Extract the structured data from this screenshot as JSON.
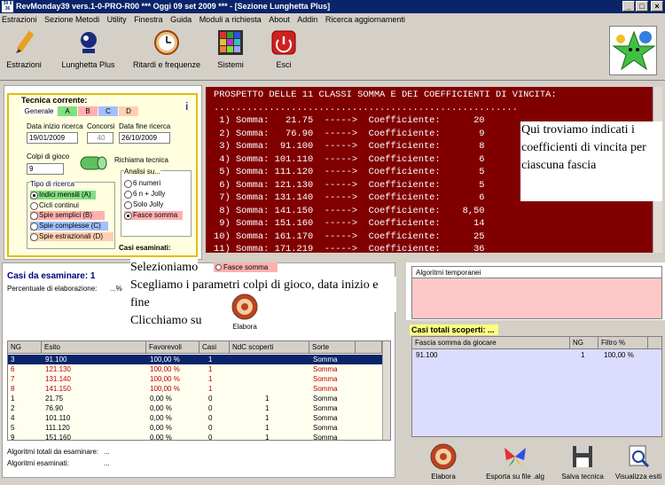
{
  "window": {
    "title": "RevMonday39 vers.1-0-PRO-R00   ***  Oggi 09 set 2009  ***   - [Sezione Lunghetta Plus]",
    "app_icon_text": "39 II 36"
  },
  "menu": [
    "Estrazioni",
    "Sezione Metodi",
    "Utility",
    "Finestra",
    "Guida",
    "Moduli a richiesta",
    "About",
    "Addin",
    "Ricerca aggiornamenti"
  ],
  "toolbar": [
    {
      "label": "Estrazioni",
      "icon": "pencil-icon"
    },
    {
      "label": "Lunghetta Plus",
      "icon": "lottery-icon"
    },
    {
      "label": "Ritardi e frequenze",
      "icon": "clock-icon"
    },
    {
      "label": "Sistemi",
      "icon": "grid-icon"
    },
    {
      "label": "Esci",
      "icon": "exit-icon"
    }
  ],
  "tecnica": {
    "title": "Tecnica corrente:",
    "tabs": [
      "Generale",
      "A",
      "B",
      "C",
      "D"
    ],
    "data_inizio_label": "Data inizio ricerca",
    "data_inizio": "19/01/2009",
    "concorsi_label": "Concorsi",
    "concorsi": "40",
    "data_fine_label": "Data fine ricerca",
    "data_fine": "26/10/2009",
    "colpi_label": "Colpi di gioco",
    "colpi": "9",
    "richiama_label": "Richiama tecnica",
    "tipo_title": "Tipo di ricerca",
    "tipo_options": [
      "Indici mensili (A)",
      "Cicli continui",
      "Spie semplici (B)",
      "Spie complesse (C)",
      "Spie estrazionali (D)"
    ],
    "analisi_title": "Analisi su...",
    "analisi_options": [
      "6 numeri",
      "6 n + Jolly",
      "Solo Jolly",
      "Fasce somma"
    ],
    "casi_esaminati": "Casi esaminati:"
  },
  "prospetto": {
    "header": "PROSPETTO DELLE 11 CLASSI SOMMA E DEI COEFFICIENTI DI VINCITA:",
    "separator": ".......................................................",
    "rows": [
      " 1) Somma:   21.75  ----->  Coefficiente:      20",
      " 2) Somma:   76.90  ----->  Coefficiente:       9",
      " 3) Somma:  91.100  ----->  Coefficiente:       8",
      " 4) Somma: 101.110  ----->  Coefficiente:       6",
      " 5) Somma: 111.120  ----->  Coefficiente:       5",
      " 6) Somma: 121.130  ----->  Coefficiente:       5",
      " 7) Somma: 131.140  ----->  Coefficiente:       6",
      " 8) Somma: 141.150  ----->  Coefficiente:    8,50",
      " 9) Somma: 151.160  ----->  Coefficiente:      14",
      "10) Somma: 161.170  ----->  Coefficiente:      25",
      "11) Somma: 171.219  ----->  Coefficiente:      36"
    ]
  },
  "annotation_right": "Qui troviamo indicati i coefficienti di vincita per ciascuna fascia",
  "casi": {
    "title": "Casi da esaminare: 1",
    "percent_label": "Percentuale di elaborazione:",
    "percent_value": "...%",
    "annot_line1": "Selezioniamo",
    "annot_radio": "Fasce somma",
    "annot_line2": "Scegliamo i parametri colpi di gioco, data inizio e fine",
    "annot_line3": "Clicchiamo su",
    "elabora_label": "Elabora",
    "algo_totali": "Algoritmi totali da esaminare:",
    "algo_totali_val": "...",
    "algo_esaminati": "Algoritmi esaminati:",
    "algo_esaminati_val": "..."
  },
  "grid": {
    "headers": [
      "NG",
      "Esito",
      "Favorevoli",
      "Casi",
      "NdC scoperti",
      "Sorte"
    ],
    "rows": [
      [
        "3",
        "91.100",
        "100,00 %",
        "1",
        "",
        "Somma"
      ],
      [
        "6",
        "121.130",
        "100,00 %",
        "1",
        "",
        "Somma"
      ],
      [
        "7",
        "131.140",
        "100,00 %",
        "1",
        "",
        "Somma"
      ],
      [
        "8",
        "141.150",
        "100,00 %",
        "1",
        "",
        "Somma"
      ],
      [
        "1",
        "21.75",
        "0,00 %",
        "0",
        "1",
        "Somma"
      ],
      [
        "2",
        "76.90",
        "0,00 %",
        "0",
        "1",
        "Somma"
      ],
      [
        "4",
        "101.110",
        "0,00 %",
        "0",
        "1",
        "Somma"
      ],
      [
        "5",
        "111.120",
        "0,00 %",
        "0",
        "1",
        "Somma"
      ],
      [
        "9",
        "151.160",
        "0,00 %",
        "0",
        "1",
        "Somma"
      ]
    ]
  },
  "algoritmi_temporanei": "Algoritmi temporanei",
  "casi_totali": "Casi totali scoperti:",
  "casi_totali_val": "...",
  "fasce": {
    "headers": [
      "Fascia somma da giocare",
      "NG",
      "Filtro %"
    ],
    "rows": [
      [
        "91.100",
        "1",
        "100,00 %"
      ]
    ]
  },
  "bottom_tools": [
    "Elabora",
    "Esporta su file .alg",
    "Salva tecnica",
    "Visualizza esiti"
  ]
}
